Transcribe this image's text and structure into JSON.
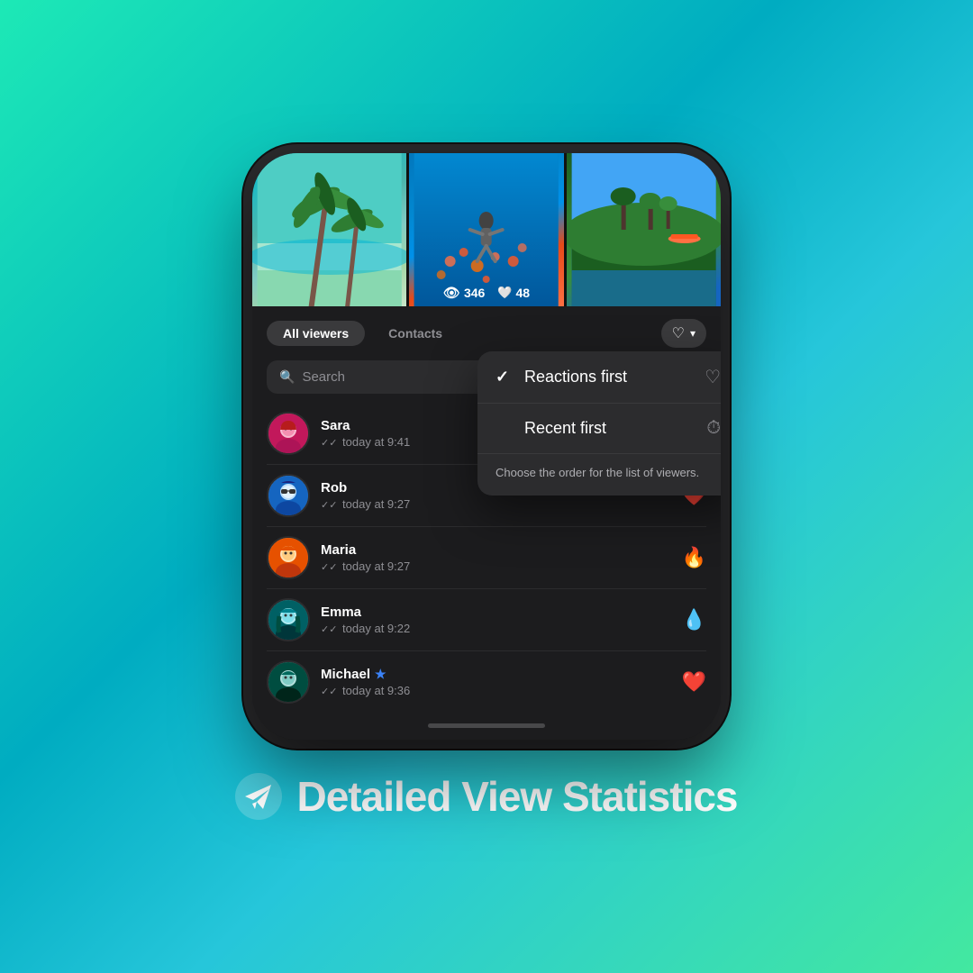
{
  "background": {
    "gradient_start": "#1de9b6",
    "gradient_end": "#43e8a0"
  },
  "phone": {
    "photos": {
      "stats": {
        "views": "346",
        "likes": "48"
      }
    },
    "viewer_panel": {
      "tab_all": "All viewers",
      "tab_contacts": "Contacts",
      "search_placeholder": "Search",
      "viewers": [
        {
          "name": "Sara",
          "time": "today at 9:41",
          "avatar_class": "sara",
          "reaction": "",
          "has_premium": false
        },
        {
          "name": "Rob",
          "time": "today at 9:27",
          "avatar_class": "rob",
          "reaction": "❤️",
          "has_premium": false
        },
        {
          "name": "Maria",
          "time": "today at 9:27",
          "avatar_class": "maria",
          "reaction": "🔥",
          "has_premium": false
        },
        {
          "name": "Emma",
          "time": "today at 9:22",
          "avatar_class": "emma",
          "reaction": "💧",
          "has_premium": false
        },
        {
          "name": "Michael",
          "time": "today at 9:36",
          "avatar_class": "michael",
          "reaction": "❤️",
          "has_premium": true
        }
      ]
    },
    "dropdown": {
      "option1_label": "Reactions first",
      "option1_icon": "♡",
      "option1_selected": true,
      "option2_label": "Recent first",
      "option2_icon": "⏱",
      "option2_selected": false,
      "tooltip": "Choose the order for the list of viewers."
    }
  },
  "footer": {
    "label": "Detailed View Statistics"
  }
}
